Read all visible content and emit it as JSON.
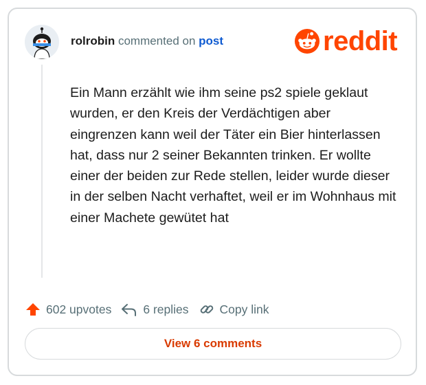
{
  "comment": {
    "username": "rolrobin",
    "action_text": "commented on",
    "post_link": "post",
    "body": "Ein Mann erzählt wie ihm seine ps2 spiele geklaut wurden, er den Kreis der Verdächtigen aber eingrenzen kann weil der Täter ein Bier hinterlassen hat, dass nur 2 seiner Bekannten trinken. Er wollte einer der beiden zur Rede stellen, leider wurde dieser in der selben Nacht verhaftet, weil er im Wohnhaus mit einer Machete gewütet hat"
  },
  "brand": {
    "wordmark": "reddit",
    "color": "#ff4500"
  },
  "actions": {
    "upvotes": "602 upvotes",
    "replies": "6 replies",
    "copy_link": "Copy link"
  },
  "view_button": "View 6 comments",
  "icons": [
    "avatar",
    "reddit-logo-icon",
    "upvote-arrow-icon",
    "reply-icon",
    "link-icon"
  ]
}
